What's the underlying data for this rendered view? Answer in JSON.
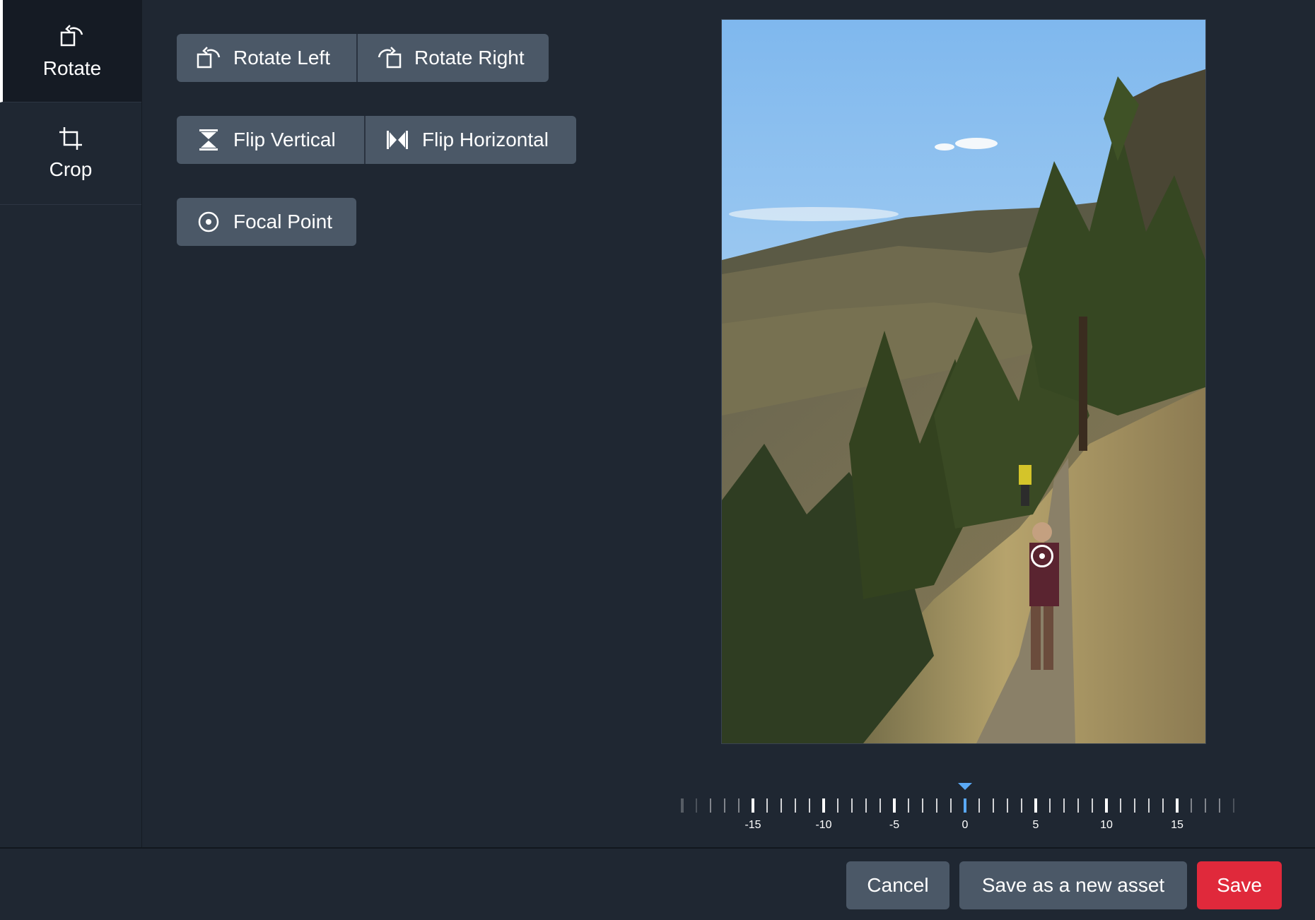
{
  "sidebar": {
    "items": [
      {
        "label": "Rotate",
        "icon": "rotate-icon",
        "active": true
      },
      {
        "label": "Crop",
        "icon": "crop-icon",
        "active": false
      }
    ]
  },
  "tools": {
    "rotate_left": "Rotate Left",
    "rotate_right": "Rotate Right",
    "flip_vertical": "Flip Vertical",
    "flip_horizontal": "Flip Horizontal",
    "focal_point": "Focal Point"
  },
  "ruler": {
    "labels": [
      "-15",
      "-10",
      "-5",
      "0",
      "5",
      "10",
      "15"
    ],
    "value": 0
  },
  "footer": {
    "cancel": "Cancel",
    "save_new": "Save as a new asset",
    "save": "Save"
  },
  "colors": {
    "background": "#1f2732",
    "button": "#4b5867",
    "primary": "#e0293b",
    "accent": "#5aa9f5"
  }
}
